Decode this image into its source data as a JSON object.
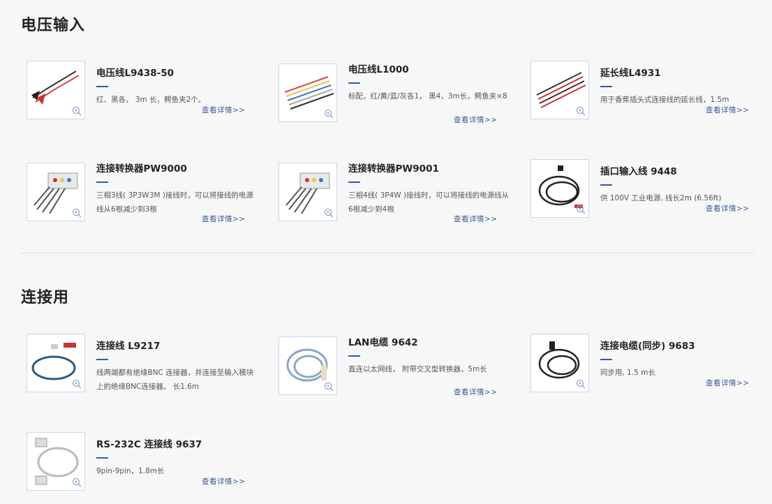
{
  "sections": [
    {
      "title": "电压输入",
      "items": [
        {
          "name": "电压线L9438-50",
          "desc": "红、黑各， 3m 长，鳄鱼夹2个。",
          "more": "查看详情>>"
        },
        {
          "name": "电压线L1000",
          "desc": "标配，红/黄/蓝/灰各1， 黑4，3m长，鳄鱼夹×8",
          "more": "查看详情>>"
        },
        {
          "name": "延长线L4931",
          "desc": "用于香蕉插头式连接线的延长线，1.5m",
          "more": "查看详情>>"
        },
        {
          "name": "连接转换器PW9000",
          "desc": "三相3线( 3P3W3M )接线时，可以将接线的电源线从6根减少到3根",
          "more": "查看详情>>"
        },
        {
          "name": "连接转换器PW9001",
          "desc": "三相4线( 3P4W )接线时，可以将接线的电源线从6根减少到4根",
          "more": "查看详情>>"
        },
        {
          "name": "插口输入线 9448",
          "desc": "供 100V 工业电源, 线长2m (6.56ft)",
          "more": "查看详情>>"
        }
      ]
    },
    {
      "title": "连接用",
      "items": [
        {
          "name": "连接线 L9217",
          "desc": "线两端都有绝缘BNC 连接器，并连接至输入模块上的绝缘BNC连接器。 长1.6m",
          "more": "查看详情>>"
        },
        {
          "name": "LAN电缆 9642",
          "desc": "直连以太网线， 附带交叉型转换器，5m长",
          "more": "查看详情>>"
        },
        {
          "name": "连接电缆(同步) 9683",
          "desc": "同步用, 1.5 m长",
          "more": "查看详情>>"
        },
        {
          "name": "RS-232C 连接线 9637",
          "desc": "9pin-9pin，1.8m长",
          "more": "查看详情>>"
        }
      ]
    }
  ],
  "colors": {
    "accent": "#2d5fa6",
    "link": "#3a5a96",
    "thumb_border": "#c9d6e6"
  },
  "icons": {
    "zoom": "zoom-in-icon"
  }
}
